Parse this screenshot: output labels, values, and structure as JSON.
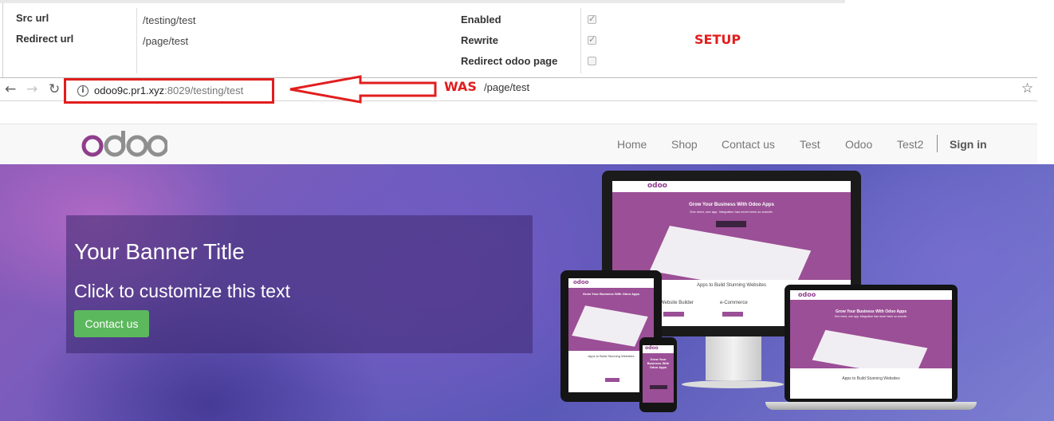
{
  "setup_form": {
    "src_url_label": "Src url",
    "src_url_value": "/testing/test",
    "redirect_url_label": "Redirect url",
    "redirect_url_value": "/page/test",
    "enabled_label": "Enabled",
    "enabled_checked": true,
    "rewrite_label": "Rewrite",
    "rewrite_checked": true,
    "redirect_odoo_label": "Redirect odoo page",
    "redirect_odoo_checked": false,
    "annotation": "SETUP",
    "annotation_color": "#e21d1d"
  },
  "browser": {
    "back_icon": "arrow-left-icon",
    "forward_icon": "arrow-right-icon",
    "reload_icon": "reload-icon",
    "url_host": "odoo9c.pr1.xyz",
    "url_rest": ":8029/testing/test",
    "was_label": "WAS",
    "was_path": "/page/test",
    "bookmark_icon": "star-icon"
  },
  "site": {
    "logo_text": "odoo",
    "menu": [
      "Home",
      "Shop",
      "Contact us",
      "Test",
      "Odoo",
      "Test2"
    ],
    "signin_label": "Sign in"
  },
  "banner": {
    "title": "Your Banner Title",
    "subtitle": "Click to customize this text",
    "button_label": "Contact us",
    "button_color": "#5cb85c"
  },
  "devices": {
    "hero_title": "Grow Your Business With Odoo Apps",
    "hero_sub": "One need, one app. Integration has never been so smooth.",
    "section_title": "Apps to Build Stunning Websites",
    "feature_1": "Website Builder",
    "feature_2": "e-Commerce",
    "phone_title": "Grow Your Business With Odoo Apps"
  }
}
